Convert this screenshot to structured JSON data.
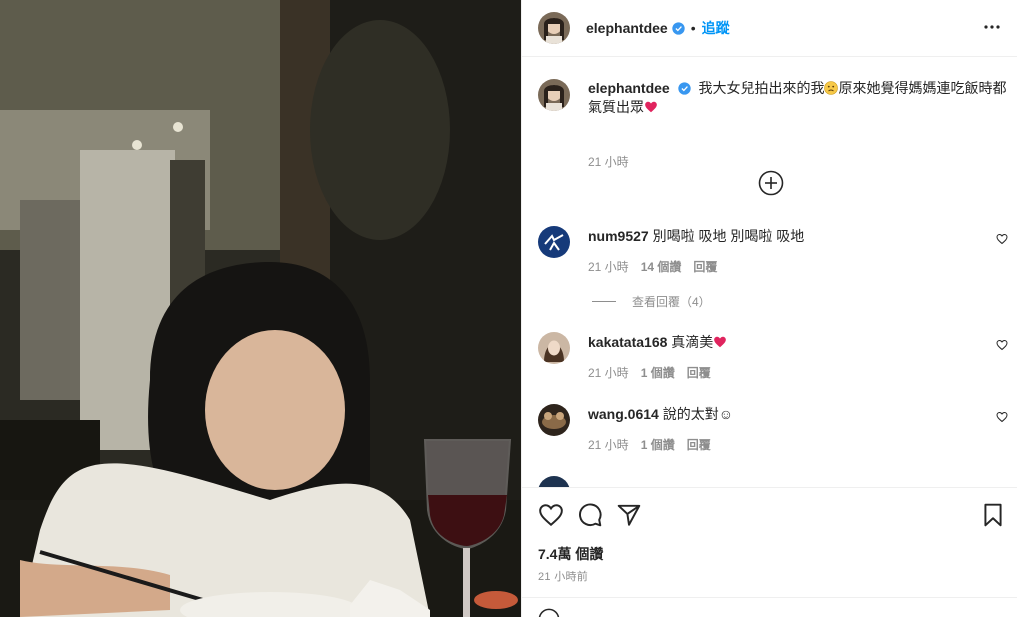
{
  "post": {
    "username": "elephantdee",
    "follow_label": "追蹤",
    "dot": "•",
    "caption_text": "我大女兒拍出來的我",
    "caption_text2": "原來她覺得媽媽連吃飯時都氣質出眾",
    "caption_time": "21 小時",
    "likes": "7.4萬 個讚",
    "posted_time": "21 小時前"
  },
  "comments": [
    {
      "username": "num9527",
      "text": "別喝啦 吸地 別喝啦 吸地",
      "time": "21 小時",
      "likes": "14 個讚",
      "reply": "回覆"
    },
    {
      "username": "kakatata168",
      "text": "真滴美",
      "time": "21 小時",
      "likes": "1 個讚",
      "reply": "回覆"
    },
    {
      "username": "wang.0614",
      "text": "說的太對☺",
      "time": "21 小時",
      "likes": "1 個讚",
      "reply": "回覆"
    }
  ],
  "view_replies": "查看回覆（4）",
  "colors": {
    "accent": "#0095f6",
    "verified": "#3897f0",
    "heart": "#ed4956",
    "muted": "#8e8e8e"
  },
  "icons": [
    "more-options-icon",
    "verified-badge-icon",
    "load-more-icon",
    "heart-icon",
    "comment-icon",
    "share-icon",
    "bookmark-icon",
    "emoji-icon"
  ]
}
